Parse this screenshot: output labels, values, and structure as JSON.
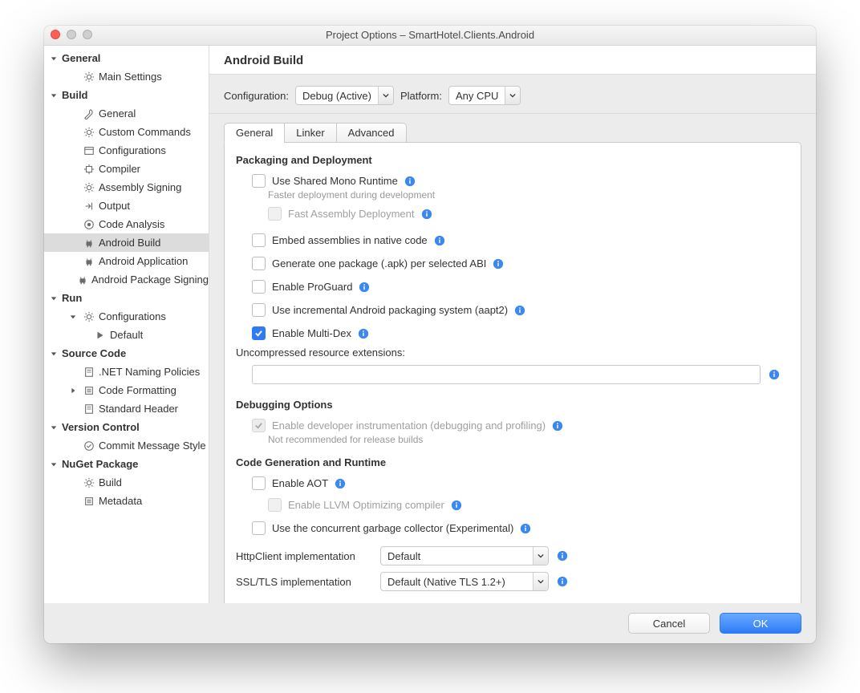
{
  "window": {
    "title": "Project Options – SmartHotel.Clients.Android"
  },
  "sidebar": {
    "groups": [
      {
        "label": "General",
        "items": [
          {
            "icon": "gear",
            "label": "Main Settings"
          }
        ]
      },
      {
        "label": "Build",
        "items": [
          {
            "icon": "wrench",
            "label": "General"
          },
          {
            "icon": "gear",
            "label": "Custom Commands"
          },
          {
            "icon": "window",
            "label": "Configurations"
          },
          {
            "icon": "chip",
            "label": "Compiler"
          },
          {
            "icon": "gear",
            "label": "Assembly Signing"
          },
          {
            "icon": "out",
            "label": "Output"
          },
          {
            "icon": "target",
            "label": "Code Analysis"
          },
          {
            "icon": "android",
            "label": "Android Build",
            "selected": true
          },
          {
            "icon": "android",
            "label": "Android Application"
          },
          {
            "icon": "android",
            "label": "Android Package Signing"
          }
        ]
      },
      {
        "label": "Run",
        "items": [
          {
            "icon": "gear",
            "label": "Configurations",
            "expanded": true,
            "children": [
              {
                "icon": "play",
                "label": "Default"
              }
            ]
          }
        ]
      },
      {
        "label": "Source Code",
        "items": [
          {
            "icon": "doc",
            "label": ".NET Naming Policies"
          },
          {
            "icon": "list",
            "label": "Code Formatting",
            "collapsed": true
          },
          {
            "icon": "doc",
            "label": "Standard Header"
          }
        ]
      },
      {
        "label": "Version Control",
        "items": [
          {
            "icon": "check",
            "label": "Commit Message Style"
          }
        ]
      },
      {
        "label": "NuGet Package",
        "items": [
          {
            "icon": "gear",
            "label": "Build"
          },
          {
            "icon": "list",
            "label": "Metadata"
          }
        ]
      }
    ]
  },
  "content": {
    "heading": "Android Build",
    "config_label": "Configuration:",
    "config_value": "Debug (Active)",
    "platform_label": "Platform:",
    "platform_value": "Any CPU",
    "tabs": {
      "general": "General",
      "linker": "Linker",
      "advanced": "Advanced"
    },
    "section_pd": "Packaging and Deployment",
    "use_shared_mono": "Use Shared Mono Runtime",
    "use_shared_mono_hint": "Faster deployment during development",
    "fast_assembly": "Fast Assembly Deployment",
    "embed_assemblies": "Embed assemblies in native code",
    "gen_apk_abi": "Generate one package (.apk) per selected ABI",
    "enable_proguard": "Enable ProGuard",
    "use_aapt2": "Use incremental Android packaging system (aapt2)",
    "enable_multidex": "Enable Multi-Dex",
    "uncompressed_label": "Uncompressed resource extensions:",
    "uncompressed_value": "",
    "section_debug": "Debugging Options",
    "dev_instr": "Enable developer instrumentation (debugging and profiling)",
    "dev_instr_hint": "Not recommended for release builds",
    "section_codegen": "Code Generation and Runtime",
    "enable_aot": "Enable AOT",
    "enable_llvm": "Enable LLVM Optimizing compiler",
    "concurrent_gc": "Use the concurrent garbage collector (Experimental)",
    "httpclient_label": "HttpClient implementation",
    "httpclient_value": "Default",
    "ssltls_label": "SSL/TLS implementation",
    "ssltls_value": "Default (Native TLS 1.2+)"
  },
  "footer": {
    "cancel": "Cancel",
    "ok": "OK"
  }
}
